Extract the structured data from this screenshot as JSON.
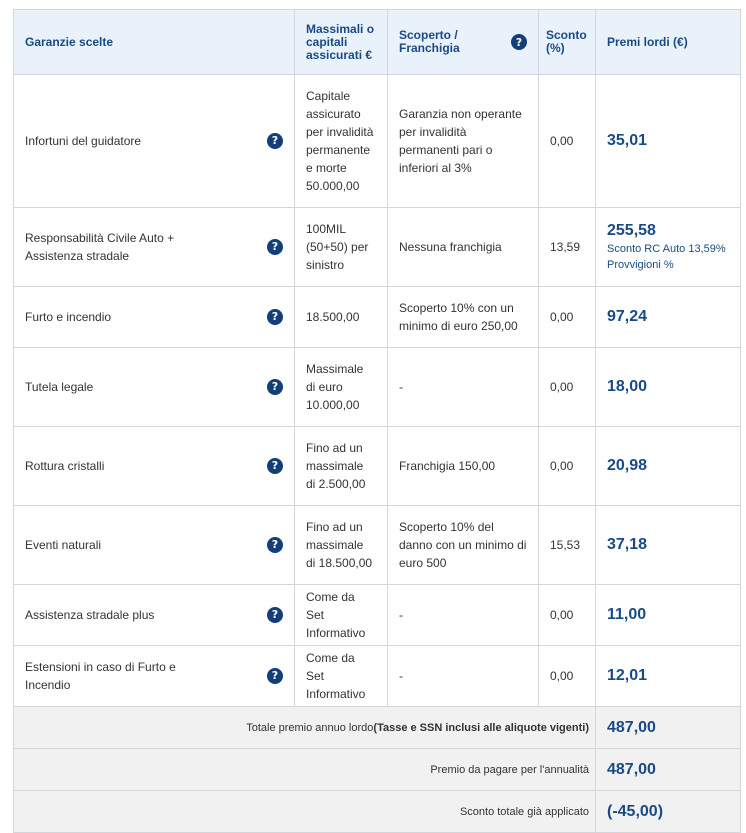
{
  "headers": {
    "garanzie": "Garanzie scelte",
    "massimali": "Massimali o capitali assicurati €",
    "scoperto": "Scoperto / Franchigia",
    "sconto": "Sconto (%)",
    "premi": "Premi lordi (€)"
  },
  "rows": [
    {
      "name": "Infortuni del guidatore",
      "massimale": "Capitale assicurato per invalidità permanente e morte 50.000,00",
      "scoperto": "Garanzia non operante per invalidità permanenti pari o inferiori al 3%",
      "sconto": "0,00",
      "premio": "35,01"
    },
    {
      "name": "Responsabilità Civile Auto + Assistenza stradale",
      "massimale": "100MIL (50+50) per sinistro",
      "scoperto": "Nessuna franchigia",
      "sconto": "13,59",
      "premio": "255,58",
      "sub1": "Sconto RC Auto 13,59%",
      "sub2": "Provvigioni %"
    },
    {
      "name": "Furto e incendio",
      "massimale": "18.500,00",
      "scoperto": "Scoperto 10% con un minimo di euro 250,00",
      "sconto": "0,00",
      "premio": "97,24"
    },
    {
      "name": "Tutela legale",
      "massimale": "Massimale di euro 10.000,00",
      "scoperto": "-",
      "sconto": "0,00",
      "premio": "18,00"
    },
    {
      "name": "Rottura cristalli",
      "massimale": "Fino ad un massimale di 2.500,00",
      "scoperto": "Franchigia 150,00",
      "sconto": "0,00",
      "premio": "20,98"
    },
    {
      "name": "Eventi naturali",
      "massimale": "Fino ad un massimale di 18.500,00",
      "scoperto": "Scoperto 10% del danno con un minimo di euro 500",
      "sconto": "15,53",
      "premio": "37,18"
    },
    {
      "name": "Assistenza stradale plus",
      "massimale": "Come da Set Informativo",
      "scoperto": "-",
      "sconto": "0,00",
      "premio": "11,00"
    },
    {
      "name": "Estensioni in caso di Furto e Incendio",
      "massimale": "Come da Set Informativo",
      "scoperto": "-",
      "sconto": "0,00",
      "premio": "12,01"
    }
  ],
  "totals": {
    "annuo_label": "Totale premio annuo lordo",
    "annuo_label_bold": "(Tasse e SSN inclusi alle aliquote vigenti)",
    "annuo_value": "487,00",
    "annualita_label": "Premio da pagare per l'annualità",
    "annualita_value": "487,00",
    "sconto_label": "Sconto totale già applicato",
    "sconto_value": "(-45,00)"
  },
  "help_icon_glyph": "?",
  "colors": {
    "header_bg": "#e9f1fb",
    "accent": "#1a4a86",
    "icon": "#123e7a",
    "footer_bg": "#f1f1f1"
  }
}
